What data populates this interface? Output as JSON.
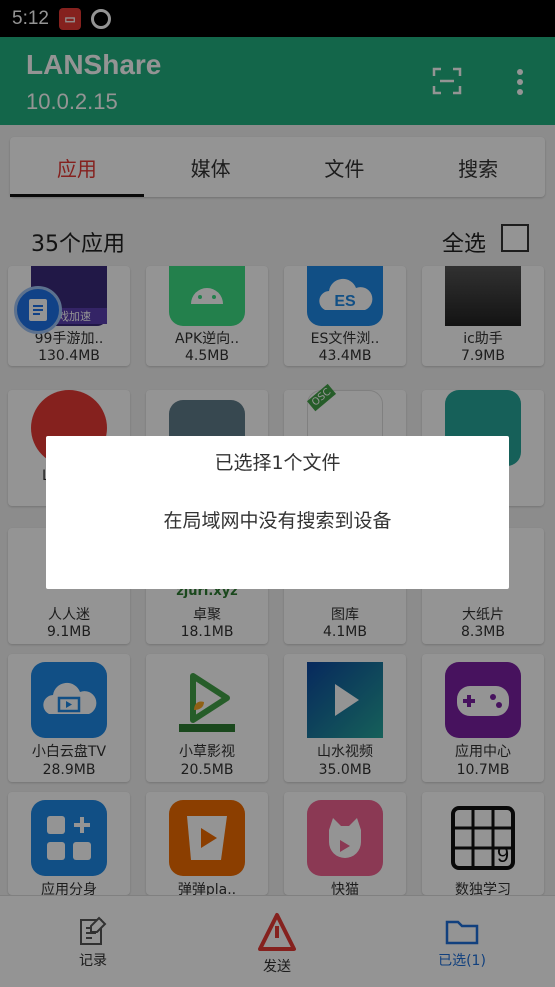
{
  "status_bar": {
    "time": "5:12"
  },
  "app_bar": {
    "title": "LANShare",
    "subtitle": "10.0.2.15"
  },
  "tabs": [
    {
      "label": "应用"
    },
    {
      "label": "媒体"
    },
    {
      "label": "文件"
    },
    {
      "label": "搜索"
    }
  ],
  "list_header": {
    "count": "35个应用",
    "select_all": "全选"
  },
  "apps": [
    {
      "name": "99手游加..",
      "size": "130.4MB",
      "color": "#3a2a7a"
    },
    {
      "name": "APK逆向..",
      "size": "4.5MB",
      "color": "#3ddc84"
    },
    {
      "name": "ES文件浏..",
      "size": "43.4MB",
      "color": "#1e88e5"
    },
    {
      "name": "ic助手",
      "size": "7.9MB",
      "color": "#444444"
    },
    {
      "name": "人人迷",
      "size": "9.1MB",
      "color": "#e53935"
    },
    {
      "name": "卓聚",
      "size": "18.1MB",
      "color": "#607d8b"
    },
    {
      "name": "图库",
      "size": "4.1MB",
      "color": "#ffffff"
    },
    {
      "name": "大纸片",
      "size": "8.3MB",
      "color": "#26a69a"
    },
    {
      "name": "小白云盘TV",
      "size": "28.9MB",
      "color": "#1e88e5"
    },
    {
      "name": "小草影视",
      "size": "20.5MB",
      "color": "#ffffff"
    },
    {
      "name": "山水视频",
      "size": "35.0MB",
      "color": "#1565c0"
    },
    {
      "name": "应用中心",
      "size": "10.7MB",
      "color": "#7b1fa2"
    },
    {
      "name": "应用分身",
      "size": "",
      "color": "#1e88e5"
    },
    {
      "name": "弹弹pla..",
      "size": "",
      "color": "#ef6c00"
    },
    {
      "name": "快猫",
      "size": "",
      "color": "#f06292"
    },
    {
      "name": "数独学习",
      "size": "",
      "color": "#ffffff"
    }
  ],
  "partial_labels": {
    "row2_first": "L"
  },
  "badges": {
    "sticker": "游戏加速",
    "osc": "OSC",
    "zjuri": "zjuri.xyz"
  },
  "bottom_nav": [
    {
      "label": "记录"
    },
    {
      "label": "发送"
    },
    {
      "label": "已选(1)"
    }
  ],
  "dialog": {
    "title": "已选择1个文件",
    "message": "在局域网中没有搜索到设备"
  },
  "colors": {
    "accent": "#22b080",
    "tab_active": "#e53935",
    "nav_selected": "#1e6fd9"
  }
}
